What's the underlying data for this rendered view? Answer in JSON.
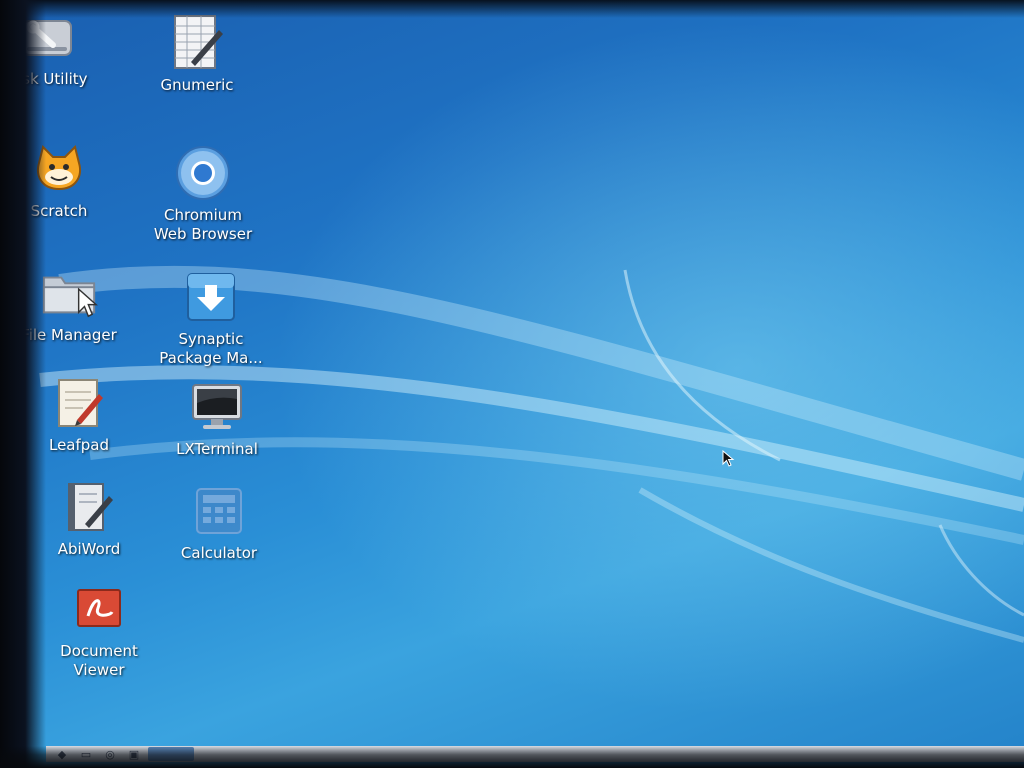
{
  "desktop": {
    "icons": [
      {
        "label": "Disk Utility",
        "icon": "disk-utility-icon"
      },
      {
        "label": "Gnumeric",
        "icon": "spreadsheet-icon"
      },
      {
        "label": "Scratch",
        "icon": "scratch-cat-icon"
      },
      {
        "label": "Chromium\nWeb Browser",
        "icon": "chromium-icon"
      },
      {
        "label": "File Manager",
        "icon": "folder-icon"
      },
      {
        "label": "Synaptic\nPackage Ma...",
        "icon": "package-download-icon"
      },
      {
        "label": "Leafpad",
        "icon": "text-editor-icon"
      },
      {
        "label": "LXTerminal",
        "icon": "terminal-monitor-icon"
      },
      {
        "label": "AbiWord",
        "icon": "word-processor-icon"
      },
      {
        "label": "Calculator",
        "icon": "calculator-icon"
      },
      {
        "label": "Document\nViewer",
        "icon": "pdf-viewer-icon"
      }
    ]
  },
  "taskbar": {
    "launchers": [
      {
        "icon": "menu-icon"
      },
      {
        "icon": "file-manager-icon"
      },
      {
        "icon": "browser-icon"
      },
      {
        "icon": "terminal-icon"
      },
      {
        "icon": "desktop-switch-icon"
      }
    ]
  },
  "colors": {
    "wallpaper_dark": "#1a5fb0",
    "wallpaper_light": "#3aa3df",
    "label_text": "#ffffff"
  }
}
